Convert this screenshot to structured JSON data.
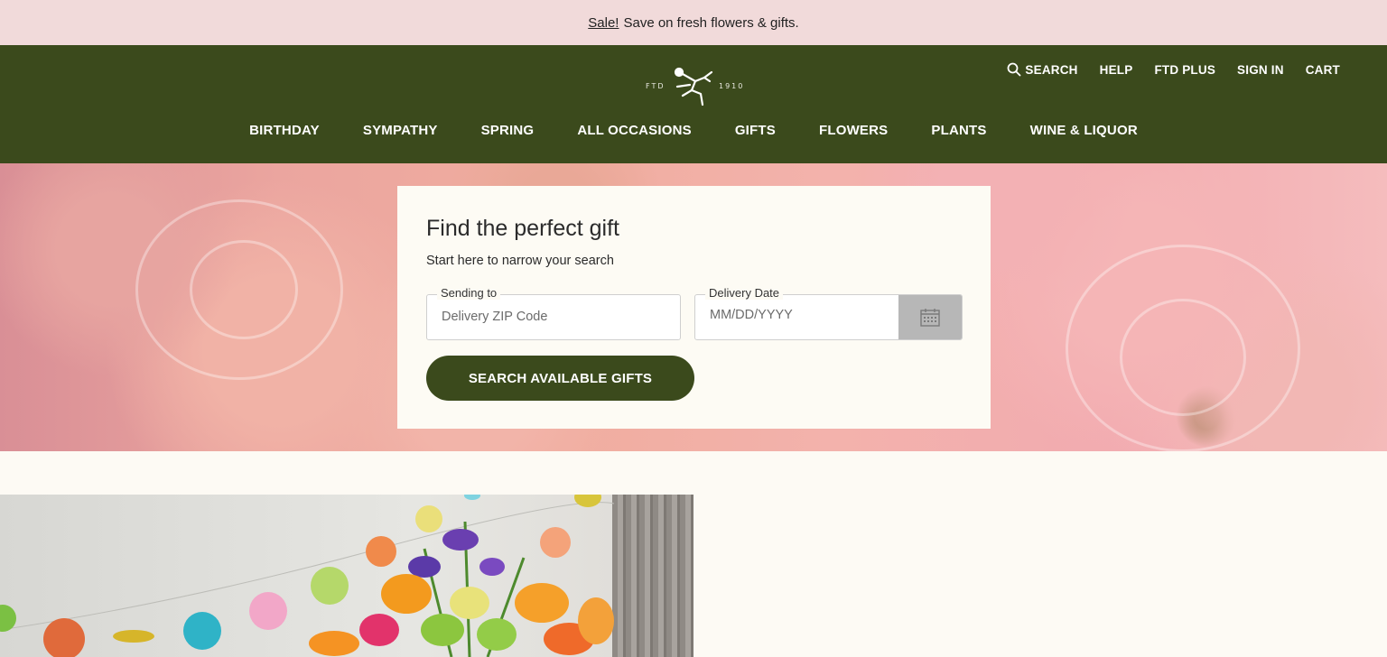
{
  "promo": {
    "link": "Sale!",
    "text": "Save on fresh flowers & gifts."
  },
  "logo": {
    "left": "FTD",
    "right": "1910"
  },
  "utility_nav": [
    {
      "label": "SEARCH",
      "icon": "search-icon"
    },
    {
      "label": "HELP"
    },
    {
      "label": "FTD PLUS"
    },
    {
      "label": "SIGN IN"
    },
    {
      "label": "CART"
    }
  ],
  "main_nav": [
    "BIRTHDAY",
    "SYMPATHY",
    "SPRING",
    "ALL OCCASIONS",
    "GIFTS",
    "FLOWERS",
    "PLANTS",
    "WINE & LIQUOR"
  ],
  "finder": {
    "title": "Find the perfect gift",
    "subtitle": "Start here to narrow your search",
    "zip_label": "Sending to",
    "zip_placeholder": "Delivery ZIP Code",
    "date_label": "Delivery Date",
    "date_placeholder": "MM/DD/YYYY",
    "calendar_icon": "calendar-icon",
    "button": "SEARCH AVAILABLE GIFTS"
  },
  "colors": {
    "brand_green": "#3b4a1c",
    "promo_bg": "#f1dada",
    "page_bg": "#fdfaf4"
  }
}
